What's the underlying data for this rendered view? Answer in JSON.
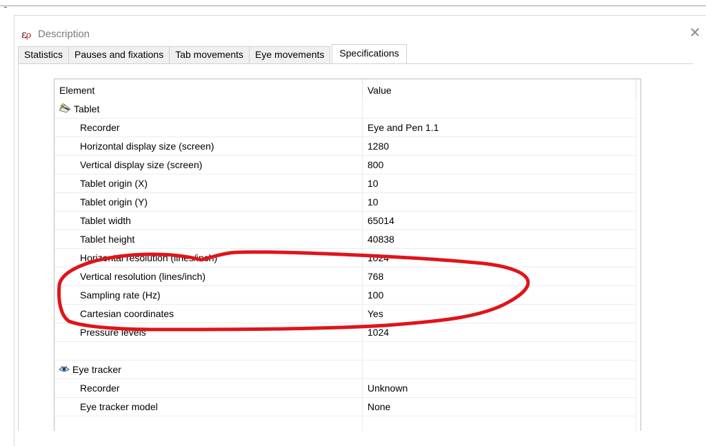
{
  "window": {
    "title": "Description",
    "icon_text": "ε",
    "icon_sub": "ρ",
    "close_glyph": "✕"
  },
  "tabs": [
    {
      "label": "Statistics"
    },
    {
      "label": "Pauses and fixations"
    },
    {
      "label": "Tab movements"
    },
    {
      "label": "Eye movements"
    },
    {
      "label": "Specifications",
      "active": true
    }
  ],
  "table": {
    "columns": [
      "Element",
      "Value"
    ],
    "rows": [
      {
        "type": "group",
        "icon": "tablet-icon",
        "element": "Tablet",
        "value": ""
      },
      {
        "element": "Recorder",
        "value": "Eye and Pen 1.1"
      },
      {
        "element": "Horizontal display size (screen)",
        "value": "1280"
      },
      {
        "element": "Vertical display size (screen)",
        "value": "800"
      },
      {
        "element": "Tablet origin (X)",
        "value": "10"
      },
      {
        "element": "Tablet origin (Y)",
        "value": "10"
      },
      {
        "element": "Tablet width",
        "value": "65014"
      },
      {
        "element": "Tablet height",
        "value": "40838"
      },
      {
        "element": "Horizontal resolution (lines/inch)",
        "value": "1024"
      },
      {
        "element": "Vertical resolution (lines/inch)",
        "value": "768"
      },
      {
        "element": "Sampling rate (Hz)",
        "value": "100"
      },
      {
        "element": "Cartesian coordinates",
        "value": "Yes"
      },
      {
        "element": "Pressure levels",
        "value": "1024"
      },
      {
        "element": "",
        "value": ""
      },
      {
        "type": "group",
        "icon": "eye-tracker-icon",
        "element": "Eye tracker",
        "value": ""
      },
      {
        "element": "Recorder",
        "value": "Unknown"
      },
      {
        "element": "Eye tracker model",
        "value": "None"
      },
      {
        "element": "",
        "value": ""
      }
    ]
  },
  "colors": {
    "annotation_stroke": "#e0141a",
    "rho_accent": "#d01818"
  }
}
